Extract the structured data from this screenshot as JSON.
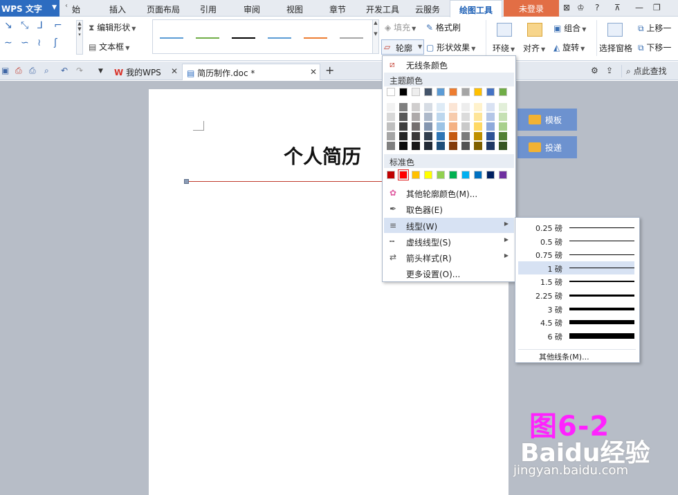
{
  "menubar": {
    "app_name": "WPS 文字",
    "items": [
      "始",
      "插入",
      "页面布局",
      "引用",
      "审阅",
      "视图",
      "章节",
      "开发工具",
      "云服务"
    ],
    "active_tab": "绘图工具",
    "login": "未登录",
    "help": "?"
  },
  "ribbon": {
    "edit_shape": "编辑形状",
    "text_box": "文本框",
    "fill": "填充",
    "format_brush": "格式刷",
    "outline": "轮廓",
    "shape_effect": "形状效果",
    "wrap": "环绕",
    "align": "对齐",
    "group": "组合",
    "rotate": "旋转",
    "select_pane": "选择窗格",
    "bring_forward": "上移一",
    "send_backward": "下移一",
    "style_colors": [
      "#5b9bd5",
      "#70ad47",
      "#000000",
      "#5b9bd5",
      "#ed7d31",
      "#a5a5a5"
    ]
  },
  "tabbar": {
    "my_wps": "我的WPS",
    "doc_tab": "简历制作.doc *",
    "add": "+",
    "search": "点此查找"
  },
  "document": {
    "title": "个人简历"
  },
  "side_buttons": {
    "template": "模板",
    "deliver": "投递"
  },
  "outline_menu": {
    "no_line": "无线条颜色",
    "theme_colors": "主题颜色",
    "standard_colors": "标准色",
    "more_colors": "其他轮廓颜色(M)...",
    "eyedropper": "取色器(E)",
    "line_type": "线型(W)",
    "dash_type": "虚线线型(S)",
    "arrow_style": "箭头样式(R)",
    "more_settings": "更多设置(O)...",
    "theme_top": [
      "#ffffff",
      "#000000",
      "#eeeeee",
      "#44546a",
      "#5b9bd5",
      "#ed7d31",
      "#a5a5a5",
      "#ffc000",
      "#4472c4",
      "#70ad47"
    ],
    "theme_shades": [
      [
        "#f2f2f2",
        "#7f7f7f",
        "#d0cece",
        "#d6dce4",
        "#deebf6",
        "#fbe5d5",
        "#ededed",
        "#fff2cc",
        "#d9e2f3",
        "#e2efd9"
      ],
      [
        "#d8d8d8",
        "#595959",
        "#aeaaaa",
        "#adb9ca",
        "#bdd7ee",
        "#f7cbac",
        "#dbdbdb",
        "#fee599",
        "#b4c6e7",
        "#c5e0b3"
      ],
      [
        "#bfbfbf",
        "#3f3f3f",
        "#757070",
        "#8496b0",
        "#9cc3e5",
        "#f4b183",
        "#c9c9c9",
        "#ffd965",
        "#8eaadb",
        "#a8d08d"
      ],
      [
        "#a5a5a5",
        "#262626",
        "#3a3838",
        "#323f4f",
        "#2e75b5",
        "#c55a11",
        "#7b7b7b",
        "#bf9000",
        "#2f5496",
        "#538135"
      ],
      [
        "#7f7f7f",
        "#0c0c0c",
        "#171616",
        "#222a35",
        "#1e4e79",
        "#833c0b",
        "#525252",
        "#7f6000",
        "#1f3864",
        "#375623"
      ]
    ],
    "standard": [
      "#c00000",
      "#ff0000",
      "#ffc000",
      "#ffff00",
      "#92d050",
      "#00b050",
      "#00b0f0",
      "#0070c0",
      "#002060",
      "#7030a0"
    ],
    "selected_standard_index": 1
  },
  "weight_menu": {
    "unit": "磅",
    "items": [
      {
        "label": "0.25",
        "pt": 0.25
      },
      {
        "label": "0.5",
        "pt": 0.5
      },
      {
        "label": "0.75",
        "pt": 0.75
      },
      {
        "label": "1",
        "pt": 1
      },
      {
        "label": "1.5",
        "pt": 1.5
      },
      {
        "label": "2.25",
        "pt": 2.25
      },
      {
        "label": "3",
        "pt": 3
      },
      {
        "label": "4.5",
        "pt": 4.5
      },
      {
        "label": "6",
        "pt": 6
      }
    ],
    "selected_index": 3,
    "more_lines": "其他线条(M)..."
  },
  "watermark": {
    "figure": "图6-2",
    "baidu": "Baidu经验",
    "url": "jingyan.baidu.com"
  }
}
